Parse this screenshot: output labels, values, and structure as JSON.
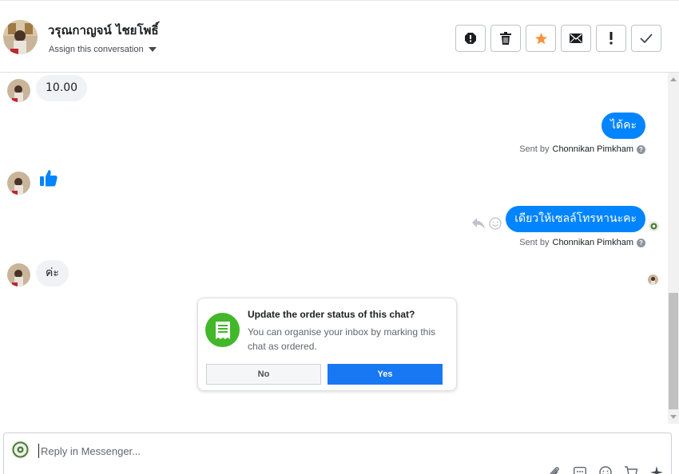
{
  "header": {
    "contact_name": "วรุณกาญจน์ ไชยโพธิ์",
    "assign_label": "Assign this conversation",
    "toolbar": [
      "spam-icon",
      "trash-icon",
      "star-icon",
      "envelope-icon",
      "exclamation-icon",
      "check-icon"
    ]
  },
  "messages": {
    "m1": "10.00",
    "m2": "ได้คะ",
    "m2_sent_prefix": "Sent by",
    "m2_sender": "Chonnikan Pimkham",
    "m4": "เดียวให้เซลล์โทรหานะคะ",
    "m4_sent_prefix": "Sent by",
    "m4_sender": "Chonnikan Pimkham",
    "m5": "ค่ะ"
  },
  "prompt": {
    "title": "Update the order status of this chat?",
    "body": "You can organise your inbox by marking this chat as ordered.",
    "no_label": "No",
    "yes_label": "Yes"
  },
  "composer": {
    "placeholder": "Reply in Messenger..."
  },
  "colors": {
    "outgoing_bubble": "#0084ff",
    "incoming_bubble": "#f0f2f5",
    "yes_button": "#1877f2",
    "prompt_icon": "#42b72a",
    "star": "#f7923b"
  }
}
